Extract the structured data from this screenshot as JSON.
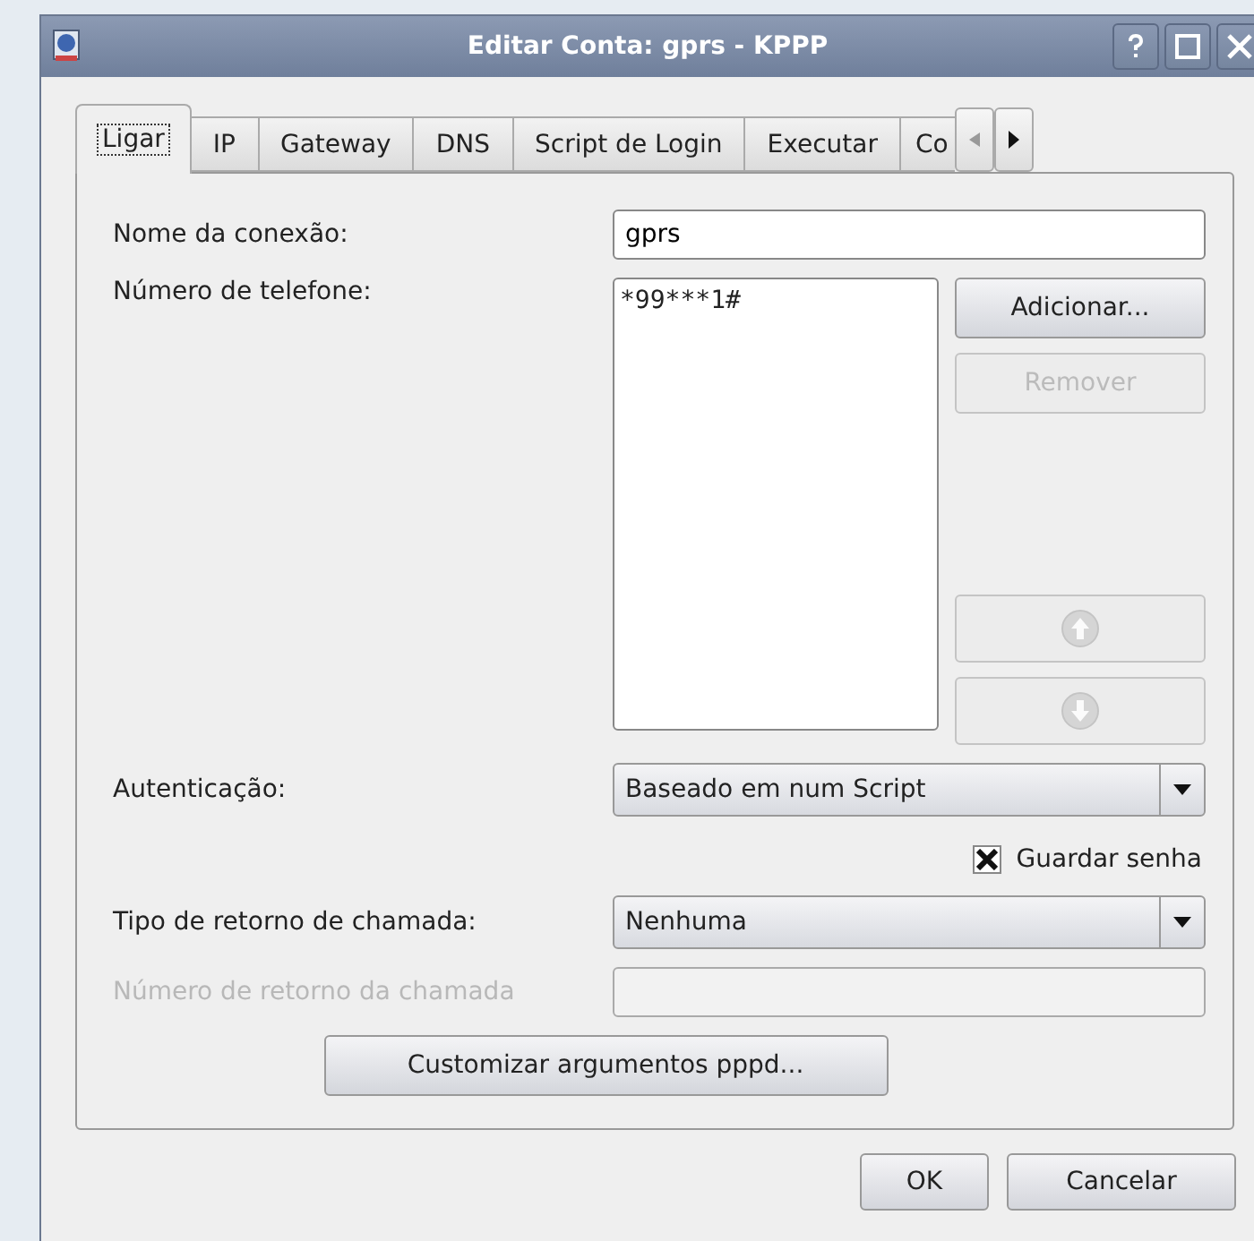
{
  "window": {
    "title": "Editar Conta: gprs - KPPP"
  },
  "tabs": [
    {
      "label": "Ligar",
      "selected": true
    },
    {
      "label": "IP",
      "selected": false
    },
    {
      "label": "Gateway",
      "selected": false
    },
    {
      "label": "DNS",
      "selected": false
    },
    {
      "label": "Script de Login",
      "selected": false
    },
    {
      "label": "Executar",
      "selected": false
    },
    {
      "label": "Co",
      "selected": false
    }
  ],
  "connection_name": {
    "label": "Nome da conexão:",
    "value": "gprs"
  },
  "phone_numbers": {
    "label": "Número de telefone:",
    "items": [
      "*99***1#"
    ],
    "buttons": [
      {
        "kind": "text",
        "label": "Adicionar...",
        "disabled": false
      },
      {
        "kind": "text",
        "label": "Remover",
        "disabled": true
      },
      {
        "kind": "up",
        "disabled": true
      },
      {
        "kind": "down",
        "disabled": true
      }
    ]
  },
  "authentication": {
    "label": "Autenticação:",
    "value": "Baseado em num Script"
  },
  "save_password": {
    "label": "Guardar senha",
    "checked": true
  },
  "callback_type": {
    "label": "Tipo de retorno de chamada:",
    "value": "Nenhuma"
  },
  "callback_number": {
    "label": "Número de retorno da chamada",
    "disabled": true
  },
  "pppd_button": {
    "label": "Customizar argumentos pppd..."
  },
  "buttons": [
    {
      "label": "OK"
    },
    {
      "label": "Cancelar"
    }
  ]
}
